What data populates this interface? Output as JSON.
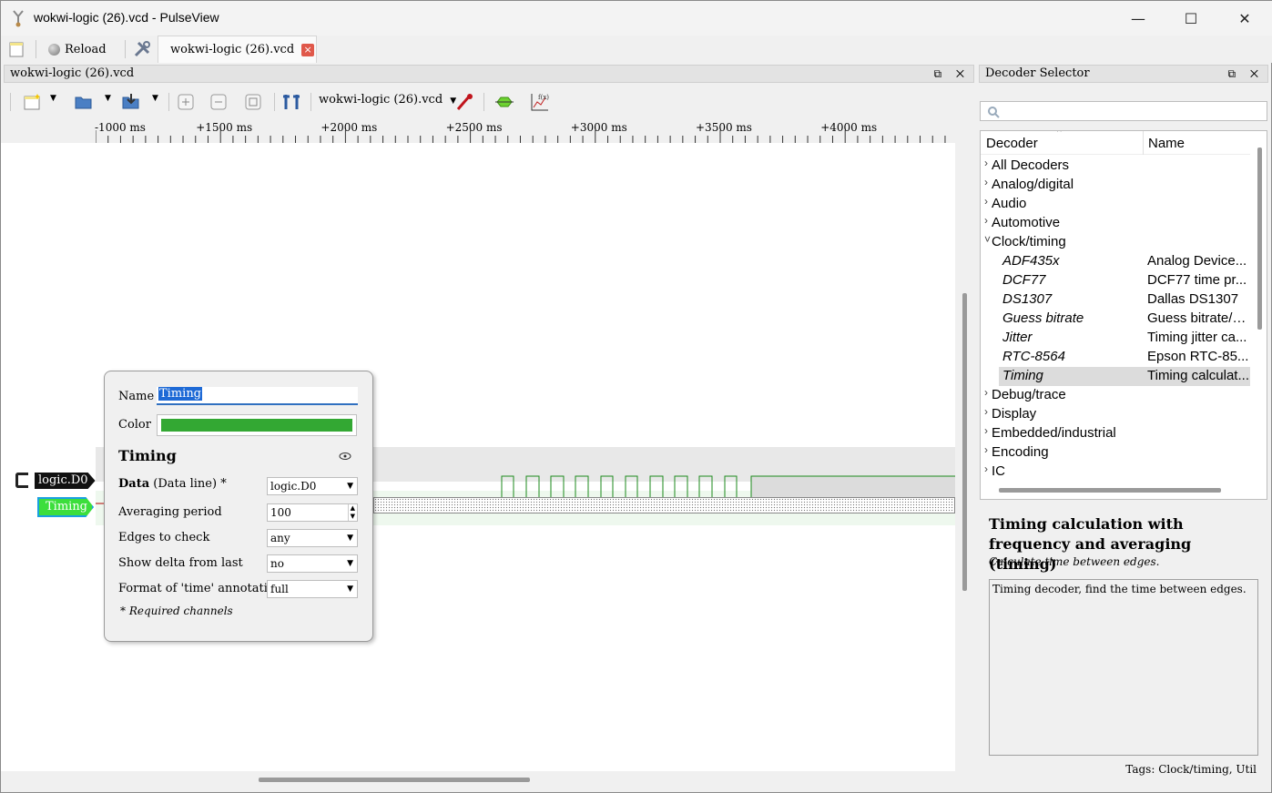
{
  "window": {
    "title": "wokwi-logic (26).vcd - PulseView",
    "minimize": "—",
    "maximize": "☐",
    "close": "✕"
  },
  "toolbar_top": {
    "reload_label": "Reload",
    "tab_label": "wokwi-logic (26).vcd",
    "tab_close": "×"
  },
  "main_dock": {
    "title": "wokwi-logic (26).vcd",
    "buttons": "⧉ ✕"
  },
  "session_toolbar": {
    "file_selector": "wokwi-logic (26).vcd"
  },
  "ruler": {
    "labels": [
      "-1000 ms",
      "+1500 ms",
      "+2000 ms",
      "+2500 ms",
      "+3000 ms",
      "+3500 ms",
      "+4000 ms"
    ]
  },
  "signals": {
    "d0_label": "logic.D0",
    "timing_label": "Timing"
  },
  "popup": {
    "name_label": "Name",
    "name_value": "Timing",
    "color_label": "Color",
    "color_value": "#33a833",
    "decoder_title": "Timing",
    "data_label": "Data",
    "data_hint": "(Data line) *",
    "data_value": "logic.D0",
    "avg_label": "Averaging period",
    "avg_value": "100",
    "edges_label": "Edges to check",
    "edges_value": "any",
    "delta_label": "Show delta from last",
    "delta_value": "no",
    "format_label": "Format of 'time' annotation",
    "format_value": "full",
    "required_note": "* Required channels"
  },
  "decoder_selector": {
    "title": "Decoder Selector",
    "buttons": "⧉ ✕",
    "col_decoder": "Decoder",
    "col_name": "Name",
    "categories_top": [
      "All Decoders",
      "Analog/digital",
      "Audio",
      "Automotive"
    ],
    "expanded_category": "Clock/timing",
    "items": [
      {
        "id": "ADF435x",
        "name": "Analog Device..."
      },
      {
        "id": "DCF77",
        "name": "DCF77 time pr..."
      },
      {
        "id": "DS1307",
        "name": "Dallas DS1307"
      },
      {
        "id": "Guess bitrate",
        "name": "Guess bitrate/b..."
      },
      {
        "id": "Jitter",
        "name": "Timing jitter ca..."
      },
      {
        "id": "RTC-8564",
        "name": "Epson RTC-85..."
      },
      {
        "id": "Timing",
        "name": "Timing calculat..."
      }
    ],
    "categories_bottom": [
      "Debug/trace",
      "Display",
      "Embedded/industrial",
      "Encoding",
      "IC"
    ],
    "detail_title": "Timing calculation with frequency and averaging (timing)",
    "detail_subtitle": "Calculate time between edges.",
    "detail_body": "Timing decoder, find the time between edges.",
    "tags": "Tags: Clock/timing, Util"
  }
}
